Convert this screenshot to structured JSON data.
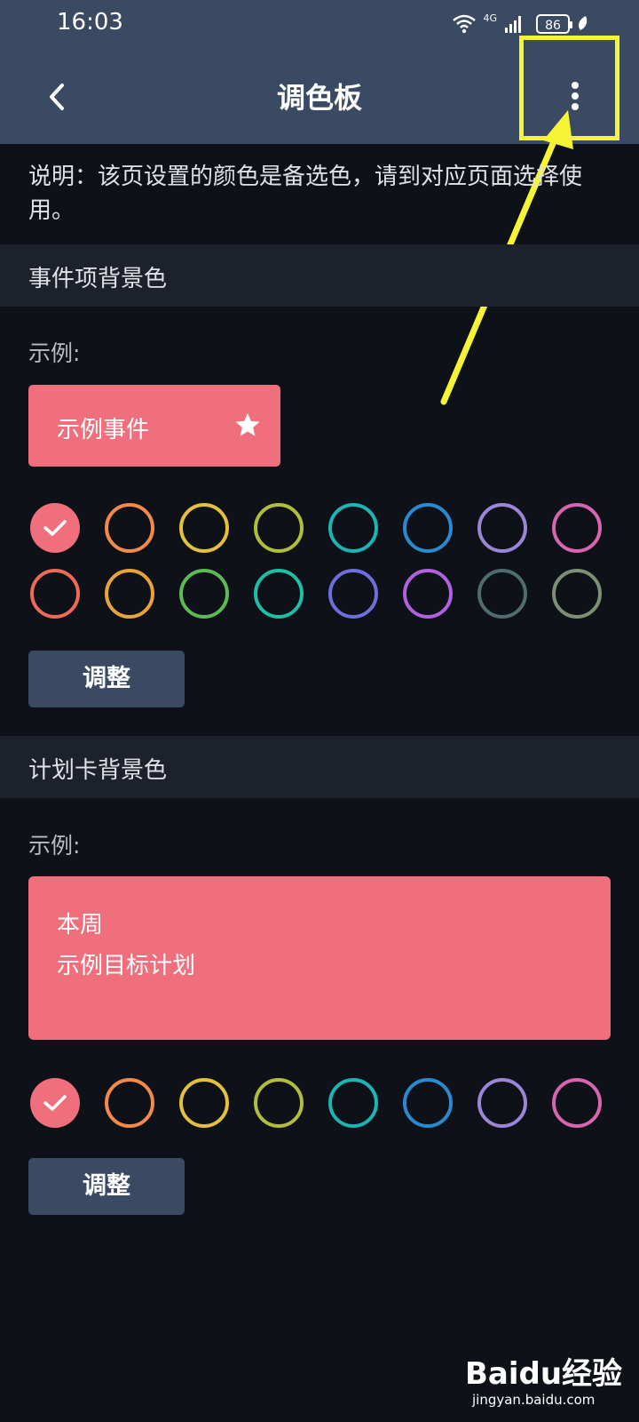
{
  "status_bar": {
    "time": "16:03",
    "network": "4G",
    "battery": "86"
  },
  "header": {
    "title": "调色板"
  },
  "notice": "说明：该页设置的颜色是备选色，请到对应页面选择使用。",
  "event_section": {
    "title": "事件项背景色",
    "example_label": "示例:",
    "sample_text": "示例事件",
    "selected_color": "#f06f7d",
    "swatch_colors": [
      "#f06f7d",
      "#f28a4a",
      "#e3c13c",
      "#b1bd3d",
      "#1db4b4",
      "#2a8ad0",
      "#9b86d6",
      "#d765b0",
      "#ee6a58",
      "#e8a33c",
      "#5dbb56",
      "#1dbfa6",
      "#6f6fdc",
      "#b161e0",
      "#4f6c6e",
      "#7f8f76"
    ],
    "adjust_label": "调整"
  },
  "plan_section": {
    "title": "计划卡背景色",
    "example_label": "示例:",
    "sample_line1": "本周",
    "sample_line2": "示例目标计划",
    "selected_color": "#f06f7d",
    "swatch_colors": [
      "#f06f7d",
      "#f28a4a",
      "#e3c13c",
      "#b1bd3d",
      "#1db4b4",
      "#2a8ad0",
      "#9b86d6",
      "#d765b0"
    ],
    "adjust_label": "调整"
  },
  "watermark": {
    "brand": "Baidu经验",
    "url": "jingyan.baidu.com"
  }
}
